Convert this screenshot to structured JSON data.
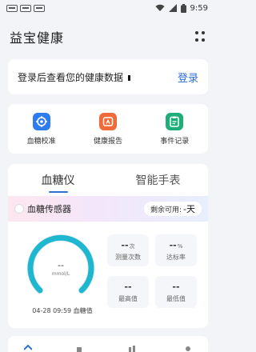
{
  "status_bar": {
    "time": "9:59"
  },
  "header": {
    "title": "益宝健康"
  },
  "login_card": {
    "hint": "登录后查看您的健康数据",
    "action": "登录"
  },
  "tools": [
    {
      "label": "血糖校准",
      "icon": "calibration-icon",
      "color": "#2f7bf0"
    },
    {
      "label": "健康报告",
      "icon": "report-icon",
      "color": "#f06a3a"
    },
    {
      "label": "事件记录",
      "icon": "event-record-icon",
      "color": "#1fae7a"
    }
  ],
  "device_tabs": {
    "active": "血糖仪",
    "inactive": "智能手表"
  },
  "sensor": {
    "name": "血糖传感器",
    "remaining_label": "剩余可用:",
    "remaining_value": "-天"
  },
  "gauge": {
    "value": "--",
    "unit": "mmol/L",
    "caption": "04-28 09:59 血糖值"
  },
  "stats": [
    {
      "value": "--",
      "suffix": "次",
      "label": "测量次数"
    },
    {
      "value": "--",
      "suffix": "%",
      "label": "达标率"
    },
    {
      "value": "--",
      "suffix": "",
      "label": "最高值"
    },
    {
      "value": "--",
      "suffix": "",
      "label": "最低值"
    }
  ],
  "colors": {
    "accent": "#2f6fd6",
    "gauge": "#1fb7cf",
    "background": "#f2f4f7"
  }
}
